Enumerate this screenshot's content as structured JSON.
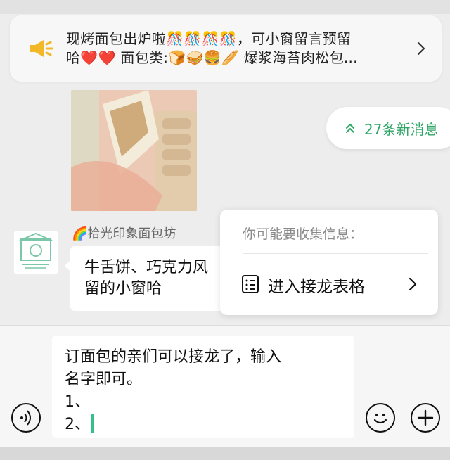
{
  "announcement": {
    "line1": "现烤面包出炉啦🎊🎊🎊🎊，可小窗留言预留",
    "line2": "哈❤️❤️ 面包类:🍞🥪🍔🥖 爆浆海苔肉松包..."
  },
  "new_messages": {
    "label": "27条新消息"
  },
  "message": {
    "sender": "🌈拾光印象面包坊",
    "line1": "牛舌饼、巧克力风",
    "line2": "留的小窗哈"
  },
  "popup": {
    "title": "你可能要收集信息：",
    "action_label": "进入接龙表格"
  },
  "composer": {
    "lines": [
      "订面包的亲们可以接龙了，输入",
      "名字即可。",
      "1、",
      "2、"
    ]
  },
  "icons": {
    "announcement": "speaker-icon",
    "voice": "voice-icon",
    "emoji": "emoji-icon",
    "more": "plus-icon"
  },
  "colors": {
    "accent_green": "#2ea665",
    "speaker_yellow": "#f2b826",
    "caret": "#35c08a"
  }
}
